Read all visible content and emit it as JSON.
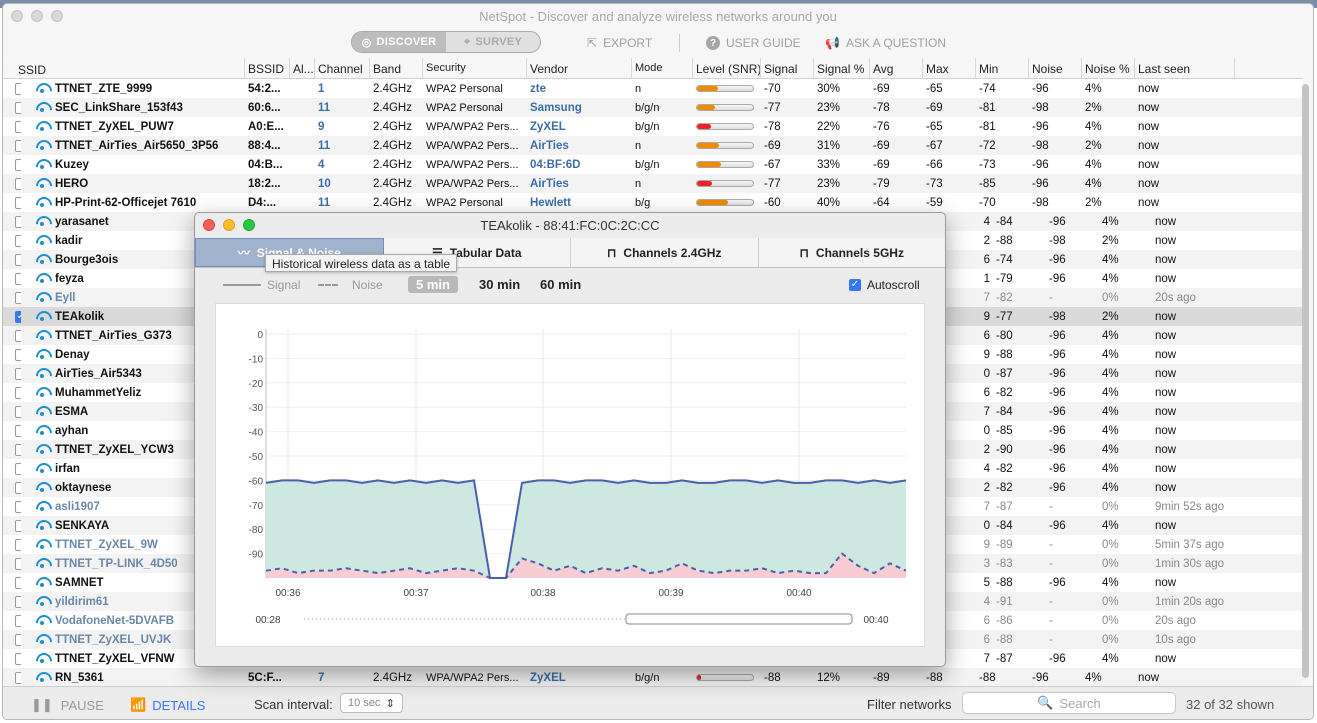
{
  "app": {
    "title": "NetSpot - Discover and analyze wireless networks around you"
  },
  "toolbar": {
    "discover": "DISCOVER",
    "survey": "SURVEY",
    "export": "EXPORT",
    "user_guide": "USER GUIDE",
    "ask": "ASK A QUESTION"
  },
  "columns": [
    "SSID",
    "BSSID",
    "Al...",
    "Channel",
    "Band",
    "Security",
    "Vendor",
    "Mode",
    "Level (SNR)",
    "Signal",
    "Signal %",
    "Avg",
    "Max",
    "Min",
    "Noise",
    "Noise %",
    "Last seen"
  ],
  "rows": [
    {
      "ssid": "TTNET_ZTE_9999",
      "bssid": "54:2...",
      "ch": "1",
      "band": "2.4GHz",
      "sec": "WPA2 Personal",
      "vendor": "zte",
      "mode": "n",
      "level": 0.38,
      "lvl_color": "#f08a00",
      "sig": "-70",
      "sp": "30%",
      "avg": "-69",
      "max": "-65",
      "min": "-74",
      "noise": "-96",
      "np": "4%",
      "last": "now"
    },
    {
      "ssid": "SEC_LinkShare_153f43",
      "bssid": "60:6...",
      "ch": "11",
      "band": "2.4GHz",
      "sec": "WPA2 Personal",
      "vendor": "Samsung",
      "mode": "b/g/n",
      "level": 0.32,
      "lvl_color": "#f08a00",
      "sig": "-77",
      "sp": "23%",
      "avg": "-78",
      "max": "-69",
      "min": "-81",
      "noise": "-98",
      "np": "2%",
      "last": "now"
    },
    {
      "ssid": "TTNET_ZyXEL_PUW7",
      "bssid": "A0:E...",
      "ch": "9",
      "band": "2.4GHz",
      "sec": "WPA/WPA2 Pers...",
      "vendor": "ZyXEL",
      "mode": "b/g/n",
      "level": 0.25,
      "lvl_color": "#e22",
      "sig": "-78",
      "sp": "22%",
      "avg": "-76",
      "max": "-65",
      "min": "-81",
      "noise": "-96",
      "np": "4%",
      "last": "now"
    },
    {
      "ssid": "TTNET_AirTies_Air5650_3P56",
      "bssid": "88:4...",
      "ch": "11",
      "band": "2.4GHz",
      "sec": "WPA/WPA2 Pers...",
      "vendor": "AirTies",
      "mode": "n",
      "level": 0.4,
      "lvl_color": "#f08a00",
      "sig": "-69",
      "sp": "31%",
      "avg": "-69",
      "max": "-67",
      "min": "-72",
      "noise": "-98",
      "np": "2%",
      "last": "now"
    },
    {
      "ssid": "Kuzey",
      "bssid": "04:B...",
      "ch": "4",
      "band": "2.4GHz",
      "sec": "WPA/WPA2 Pers...",
      "vendor": "04:BF:6D",
      "mode": "b/g/n",
      "level": 0.42,
      "lvl_color": "#f08a00",
      "sig": "-67",
      "sp": "33%",
      "avg": "-69",
      "max": "-66",
      "min": "-73",
      "noise": "-96",
      "np": "4%",
      "last": "now"
    },
    {
      "ssid": "HERO",
      "bssid": "18:2...",
      "ch": "10",
      "band": "2.4GHz",
      "sec": "WPA/WPA2 Pers...",
      "vendor": "AirTies",
      "mode": "n",
      "level": 0.27,
      "lvl_color": "#e22",
      "sig": "-77",
      "sp": "23%",
      "avg": "-79",
      "max": "-73",
      "min": "-85",
      "noise": "-96",
      "np": "4%",
      "last": "now"
    },
    {
      "ssid": "HP-Print-62-Officejet 7610",
      "bssid": "D4:...",
      "ch": "11",
      "band": "2.4GHz",
      "sec": "WPA2 Personal",
      "vendor": "Hewlett",
      "mode": "b/g",
      "level": 0.55,
      "lvl_color": "#f08a00",
      "sig": "-60",
      "sp": "40%",
      "avg": "-64",
      "max": "-59",
      "min": "-70",
      "noise": "-98",
      "np": "2%",
      "last": "now"
    },
    {
      "ssid": "yarasanet",
      "min": "-84",
      "noise": "-96",
      "np": "4%",
      "last": "now",
      "maxfrag": "4"
    },
    {
      "ssid": "kadir",
      "min": "-88",
      "noise": "-98",
      "np": "2%",
      "last": "now",
      "maxfrag": "2"
    },
    {
      "ssid": "Bourge3ois",
      "min": "-74",
      "noise": "-96",
      "np": "4%",
      "last": "now",
      "maxfrag": "6"
    },
    {
      "ssid": "feyza",
      "min": "-79",
      "noise": "-96",
      "np": "4%",
      "last": "now",
      "maxfrag": "1"
    },
    {
      "ssid": "Eyll",
      "min": "-82",
      "noise": "-",
      "np": "0%",
      "last": "20s ago",
      "gone": true,
      "maxfrag": "7"
    },
    {
      "ssid": "TEAkolik",
      "min": "-77",
      "noise": "-98",
      "np": "2%",
      "last": "now",
      "sel": true,
      "maxfrag": "9"
    },
    {
      "ssid": "TTNET_AirTies_G373",
      "min": "-80",
      "noise": "-96",
      "np": "4%",
      "last": "now",
      "maxfrag": "6"
    },
    {
      "ssid": "Denay",
      "min": "-88",
      "noise": "-96",
      "np": "4%",
      "last": "now",
      "maxfrag": "9"
    },
    {
      "ssid": "AirTies_Air5343",
      "min": "-87",
      "noise": "-96",
      "np": "4%",
      "last": "now",
      "maxfrag": "0"
    },
    {
      "ssid": "MuhammetYeliz",
      "min": "-82",
      "noise": "-96",
      "np": "4%",
      "last": "now",
      "maxfrag": "6"
    },
    {
      "ssid": "ESMA",
      "min": "-84",
      "noise": "-96",
      "np": "4%",
      "last": "now",
      "maxfrag": "7"
    },
    {
      "ssid": "ayhan",
      "min": "-85",
      "noise": "-96",
      "np": "4%",
      "last": "now",
      "maxfrag": "0"
    },
    {
      "ssid": "TTNET_ZyXEL_YCW3",
      "min": "-90",
      "noise": "-96",
      "np": "4%",
      "last": "now",
      "maxfrag": "2"
    },
    {
      "ssid": "irfan",
      "min": "-82",
      "noise": "-96",
      "np": "4%",
      "last": "now",
      "maxfrag": "4"
    },
    {
      "ssid": "oktaynese",
      "min": "-82",
      "noise": "-96",
      "np": "4%",
      "last": "now",
      "maxfrag": "2"
    },
    {
      "ssid": "asli1907",
      "min": "-87",
      "noise": "-",
      "np": "0%",
      "last": "9min 52s ago",
      "gone": true,
      "maxfrag": "7"
    },
    {
      "ssid": "SENKAYA",
      "min": "-84",
      "noise": "-96",
      "np": "4%",
      "last": "now",
      "maxfrag": "0"
    },
    {
      "ssid": "TTNET_ZyXEL_9W",
      "min": "-89",
      "noise": "-",
      "np": "0%",
      "last": "5min 37s ago",
      "gone": true,
      "maxfrag": "9"
    },
    {
      "ssid": "TTNET_TP-LINK_4D50",
      "min": "-83",
      "noise": "-",
      "np": "0%",
      "last": "1min 30s ago",
      "gone": true,
      "maxfrag": "3"
    },
    {
      "ssid": "SAMNET",
      "min": "-88",
      "noise": "-96",
      "np": "4%",
      "last": "now",
      "maxfrag": "5"
    },
    {
      "ssid": "yildirim61",
      "min": "-91",
      "noise": "-",
      "np": "0%",
      "last": "1min 20s ago",
      "gone": true,
      "maxfrag": "4"
    },
    {
      "ssid": "VodafoneNet-5DVAFB",
      "min": "-86",
      "noise": "-",
      "np": "0%",
      "last": "20s ago",
      "gone": true,
      "maxfrag": "6"
    },
    {
      "ssid": "TTNET_ZyXEL_UVJK",
      "min": "-88",
      "noise": "-",
      "np": "0%",
      "last": "10s ago",
      "gone": true,
      "maxfrag": "6"
    },
    {
      "ssid": "TTNET_ZyXEL_VFNW",
      "min": "-87",
      "noise": "-96",
      "np": "4%",
      "last": "now",
      "maxfrag": "7"
    },
    {
      "ssid": "RN_5361",
      "bssid": "5C:F...",
      "ch": "7",
      "band": "2.4GHz",
      "sec": "WPA/WPA2 Pers...",
      "vendor": "ZyXEL",
      "mode": "b/g/n",
      "level": 0.08,
      "lvl_color": "#e22",
      "sig": "-88",
      "sp": "12%",
      "avg": "-89",
      "max": "-88",
      "min": "-88",
      "noise": "-96",
      "np": "4%",
      "last": "now"
    }
  ],
  "status": {
    "pause": "PAUSE",
    "details": "DETAILS",
    "scan_label": "Scan interval:",
    "scan_value": "10 sec",
    "filter_label": "Filter networks",
    "search_placeholder": "Search",
    "count": "32 of 32 shown"
  },
  "popup": {
    "title": "TEAkolik - 88:41:FC:0C:2C:CC",
    "tabs": [
      "Signal & Noise",
      "Tabular Data",
      "Channels 2.4GHz",
      "Channels 5GHz"
    ],
    "tooltip": "Historical wireless data as a table",
    "legend_signal": "Signal",
    "legend_noise": "Noise",
    "ranges": [
      "5 min",
      "30 min",
      "60 min"
    ],
    "autoscroll": "Autoscroll"
  },
  "chart_data": {
    "type": "area",
    "ylim": [
      -100,
      0
    ],
    "yticks": [
      "0",
      "-10",
      "-20",
      "-30",
      "-40",
      "-50",
      "-60",
      "-70",
      "-80",
      "-90"
    ],
    "xticks": [
      "00:36",
      "00:37",
      "00:38",
      "00:39",
      "00:40"
    ],
    "range_start": "00:28",
    "range_end": "00:40",
    "colors": {
      "signal": "#4a5fae",
      "signal_fill": "#cce8e0",
      "noise": "#4a5fae",
      "noise_fill": "#f7cdd3"
    },
    "series": [
      {
        "name": "Signal",
        "values": [
          -61,
          -60,
          -60,
          -61,
          -60,
          -60,
          -61,
          -60,
          -61,
          -60,
          -61,
          -60,
          -61,
          -60,
          -100,
          -100,
          -61,
          -60,
          -60,
          -61,
          -60,
          -60,
          -61,
          -60,
          -61,
          -61,
          -60,
          -61,
          -61,
          -60,
          -60,
          -61,
          -60,
          -61,
          -61,
          -60,
          -60,
          -61,
          -60,
          -61,
          -60
        ]
      },
      {
        "name": "Noise",
        "values": [
          -97,
          -96,
          -98,
          -97,
          -97,
          -96,
          -97,
          -98,
          -97,
          -96,
          -98,
          -97,
          -96,
          -97,
          -100,
          -100,
          -92,
          -94,
          -97,
          -95,
          -98,
          -96,
          -97,
          -95,
          -98,
          -97,
          -94,
          -97,
          -98,
          -97,
          -97,
          -96,
          -98,
          -97,
          -98,
          -98,
          -90,
          -95,
          -98,
          -94,
          -97
        ]
      }
    ]
  }
}
